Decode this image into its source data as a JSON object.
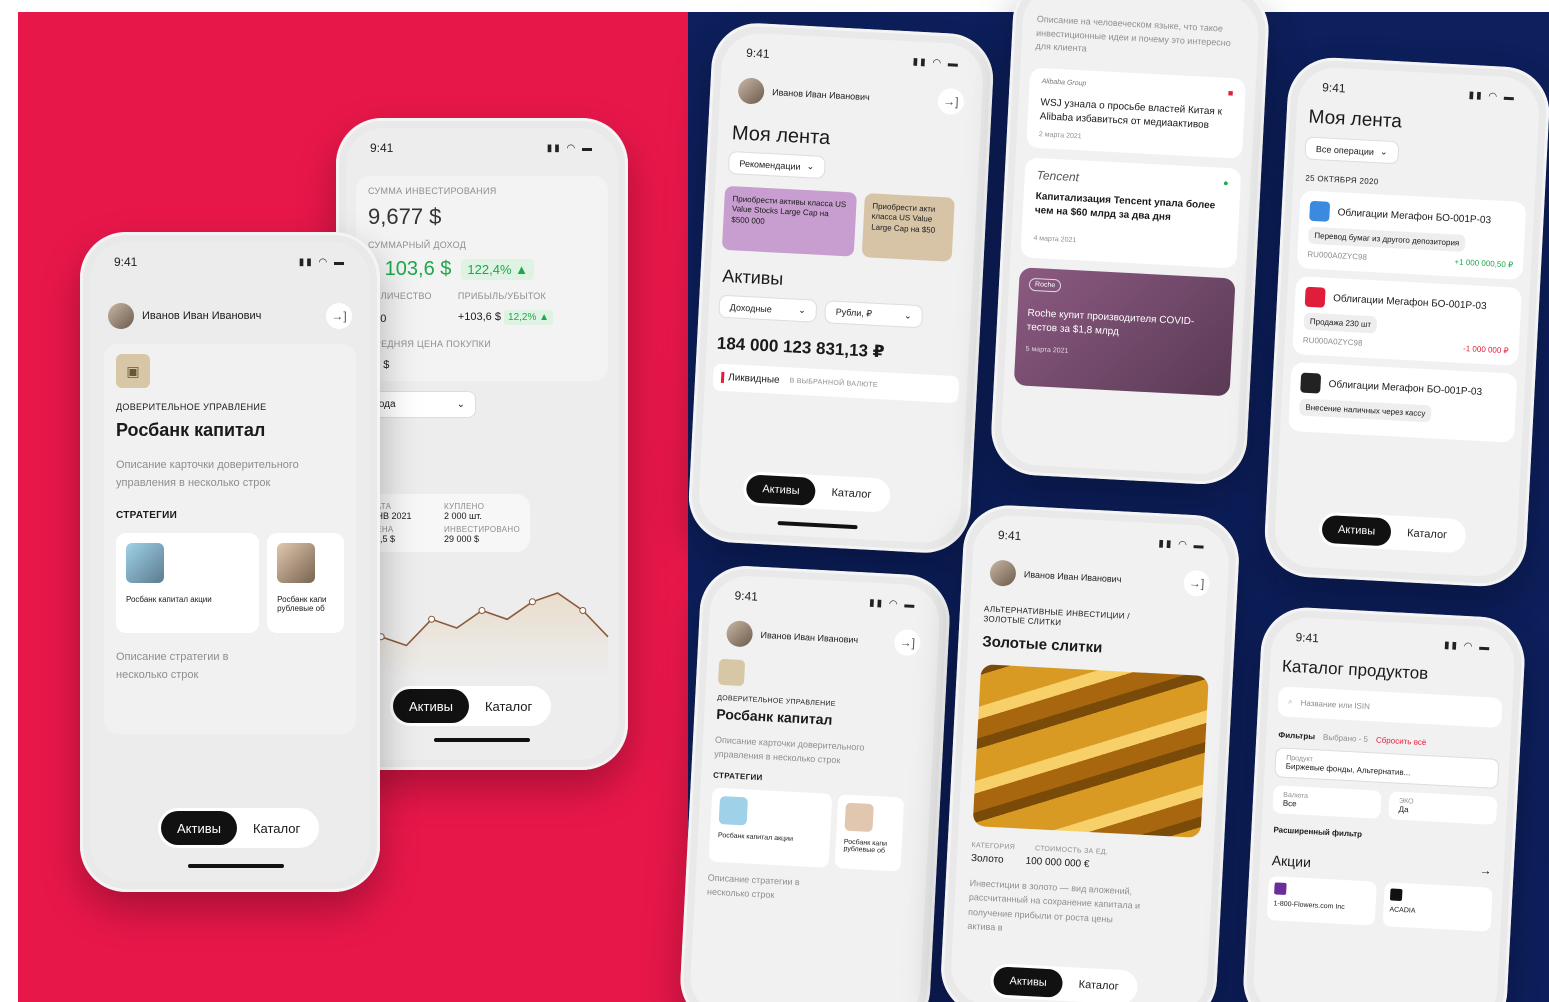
{
  "colors": {
    "red": "#e8174a",
    "navy": "#0d1f5c",
    "green": "#1ea84a",
    "redtext": "#e01e3c",
    "gold": "#d89a22"
  },
  "time": "9:41",
  "user_name": "Иванов Иван Иванович",
  "tabs": {
    "assets": "Активы",
    "catalog": "Каталог"
  },
  "trust": {
    "type": "ДОВЕРИТЕЛЬНОЕ УПРАВЛЕНИЕ",
    "title": "Росбанк капитал",
    "desc": "Описание карточки доверительного управления в несколько строк",
    "strategies_label": "СТРАТЕГИИ",
    "strategy1": "Росбанк капитал акции",
    "strategy2": "Росбанк капи рублевые об",
    "strategy_desc": "Описание стратегии в несколько строк"
  },
  "invest": {
    "sum_label": "СУММА ИНВЕСТИРОВАНИЯ",
    "sum": "9,677 $",
    "income_label": "СУММАРНЫЙ ДОХОД",
    "income": "1 103,6 $",
    "income_pct": "122,4% ▲",
    "qty_label": "КОЛИЧЕСТВО",
    "qty": "000",
    "pl_label": "ПРИБЫЛЬ/УБЫТОК",
    "pl": "+103,6 $",
    "pl_pct": "12,2% ▲",
    "avg_label": "СРЕДНЯЯ ЦЕНА ПОКУПКИ",
    "avg": "50 $",
    "period": "1 года",
    "date_label": "ДАТА",
    "date": "ЯНВ 2021",
    "bought_label": "КУПЛЕНО",
    "bought": "2 000 шт.",
    "price_label": "ЦЕНА",
    "price": "14,5 $",
    "invested_label": "ИНВЕСТИРОВАНО",
    "invested": "29 000 $"
  },
  "feed": {
    "title": "Моя лента",
    "filter": "Рекомендации",
    "promo1": "Приобрести активы класса US Value Stocks Large Cap на $500 000",
    "promo2": "Приобрести акти класса US Value Large Cap на $50",
    "assets_title": "Активы",
    "f1": "Доходные",
    "f2": "Рубли, ₽",
    "total": "184 000 123 831,13 ₽",
    "liquid": "Ликвидные",
    "currency_note": "В ВЫБРАННОЙ ВАЛЮТЕ"
  },
  "news": {
    "intro": "Описание на человеческом языке, что такое инвестиционные идеи и почему это интересно для клиента",
    "n1_src": "Alibaba Group",
    "n1": "WSJ узнала о просьбе властей Китая к Alibaba избавиться от медиаактивов",
    "n1_date": "2 марта 2021",
    "n2_src": "Tencent",
    "n2": "Капитализация Tencent упала более чем на $60 млрд за два дня",
    "n2_date": "4 марта 2021",
    "n3_src": "Roche",
    "n3": "Roche купит производителя COVID-тестов за $1,8 млрд",
    "n3_date": "5 марта 2021"
  },
  "ops": {
    "title": "Моя лента",
    "filter": "Все операции",
    "date": "25 ОКТЯБРЯ 2020",
    "o1_name": "Облигации Мегафон БО-001Р-03",
    "o1_tag": "Перевод бумаг из другого депозитория",
    "o1_isin": "RU000A0ZYC98",
    "o1_amt": "+1 000 000,50 ₽",
    "o2_name": "Облигации Мегафон БО-001Р-03",
    "o2_tag": "Продажа 230 шт",
    "o2_isin": "RU000A0ZYC98",
    "o2_amt": "-1 000 000 ₽",
    "o3_name": "Облигации Мегафон БО-001Р-03",
    "o3_tag": "Внесение наличных через кассу"
  },
  "gold": {
    "crumb": "АЛЬТЕРНАТИВНЫЕ ИНВЕСТИЦИИ / ЗОЛОТЫЕ СЛИТКИ",
    "title": "Золотые слитки",
    "cat_label": "КАТЕГОРИЯ",
    "cat": "Золото",
    "cost_label": "СТОИМОСТЬ ЗА ЕД.",
    "cost": "100 000 000 €",
    "desc": "Инвестиции в золото — вид вложений, рассчитанный на сохранение капитала и получение прибыли от роста цены актива в"
  },
  "catalog": {
    "title": "Каталог продуктов",
    "search_ph": "Название или ISIN",
    "filters": "Фильтры",
    "selected": "Выбрано - 5",
    "reset": "Сбросить всё",
    "product_label": "Продукт",
    "product": "Биржевые фонды, Альтернатив...",
    "cur_label": "Валюта",
    "cur": "Все",
    "eco_label": "ЭКО",
    "eco": "Да",
    "adv": "Расширенный фильтр",
    "shares": "Акции",
    "s1": "1-800-Flowers.com Inc",
    "s2": "ACADIA"
  },
  "chart_values": [
    2,
    5,
    4,
    7,
    6,
    8,
    7,
    9,
    10,
    8,
    5
  ]
}
